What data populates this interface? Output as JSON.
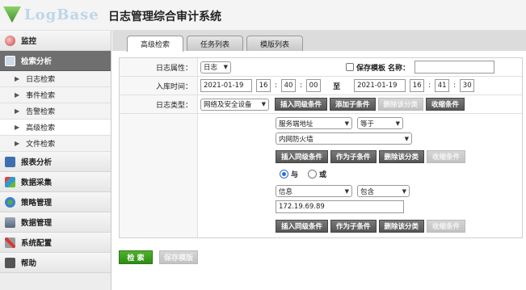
{
  "app": {
    "logo_text": "LogBase",
    "title": "日志管理综合审计系统"
  },
  "sidebar": {
    "items": [
      {
        "label": "监控",
        "icon": "monitor-icon"
      },
      {
        "label": "检索分析",
        "icon": "search-analysis-icon",
        "active": true,
        "children": [
          "日志检索",
          "事件检索",
          "告警检索",
          "高级检索",
          "文件检索"
        ],
        "selected_child": "高级检索"
      },
      {
        "label": "报表分析",
        "icon": "report-icon"
      },
      {
        "label": "数据采集",
        "icon": "data-collect-icon"
      },
      {
        "label": "策略管理",
        "icon": "policy-icon"
      },
      {
        "label": "数据管理",
        "icon": "data-manage-icon"
      },
      {
        "label": "系统配置",
        "icon": "system-config-icon"
      },
      {
        "label": "帮助",
        "icon": "help-icon"
      }
    ]
  },
  "tabs": [
    {
      "label": "高级检索",
      "active": true
    },
    {
      "label": "任务列表"
    },
    {
      "label": "模版列表"
    }
  ],
  "form": {
    "log_attr": {
      "label": "日志属性：",
      "value": "日志",
      "save_template_label": "保存模板",
      "name_label": "名称：",
      "name_value": ""
    },
    "time": {
      "label": "入库时间：",
      "start_date": "2021-01-19",
      "start_h": "16",
      "start_m": "40",
      "start_s": "00",
      "to_label": "至",
      "end_date": "2021-01-19",
      "end_h": "16",
      "end_m": "41",
      "end_s": "30",
      "sep": ":"
    },
    "log_type": {
      "label": "日志类型：",
      "value": "网络及安全设备",
      "buttons": [
        "插入同级条件",
        "添加子条件",
        "删除该分类",
        "收缩条件"
      ]
    },
    "cond1": {
      "field": "服务端地址",
      "operator": "等于",
      "value": "内网防火墙",
      "buttons": [
        "插入同级条件",
        "作为子条件",
        "删除该分类",
        "收缩条件"
      ]
    },
    "logic": {
      "and_label": "与",
      "or_label": "或",
      "selected": "与"
    },
    "cond2": {
      "field": "信息",
      "operator": "包含",
      "value": "172.19.69.89",
      "buttons": [
        "插入同级条件",
        "作为子条件",
        "删除该分类",
        "收缩条件"
      ]
    }
  },
  "actions": {
    "search_label": "检 索",
    "save_template_label": "保存模版"
  },
  "colors": {
    "search_button": "#3a9a1e",
    "sidebar_active": "#6f6f6f",
    "tab_bar": "#dcdcdc"
  }
}
